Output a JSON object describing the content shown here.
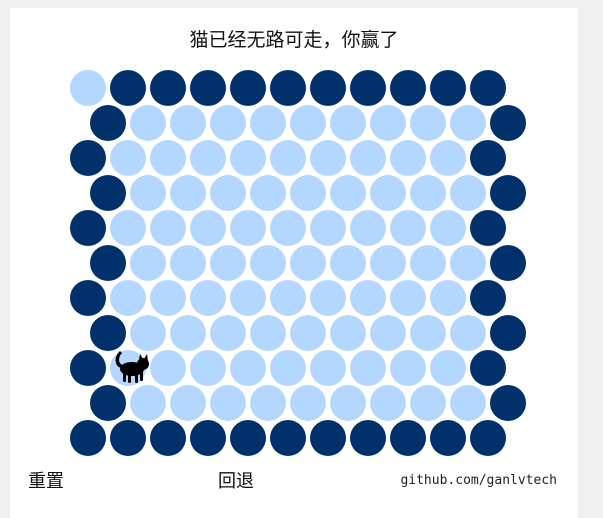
{
  "status_text": "猫已经无路可走，你赢了",
  "buttons": {
    "reset_label": "重置",
    "undo_label": "回退"
  },
  "footer_link": "github.com/ganlvtech",
  "colors": {
    "page_background": "#efefef",
    "panel_background": "#ffffff",
    "empty_cell": "#b3d7ff",
    "wall_cell": "#00316b",
    "cat": "#000000"
  },
  "board": {
    "rows": 11,
    "cols": 11,
    "cat_position": {
      "row": 8,
      "col": 1
    },
    "walls": [
      "0-1",
      "0-2",
      "0-3",
      "0-4",
      "0-5",
      "0-6",
      "0-7",
      "0-8",
      "0-9",
      "0-10",
      "1-0",
      "1-10",
      "2-0",
      "2-10",
      "3-0",
      "3-10",
      "4-0",
      "4-10",
      "5-0",
      "5-10",
      "6-0",
      "6-10",
      "7-0",
      "7-10",
      "8-0",
      "8-10",
      "9-0",
      "9-10",
      "10-0",
      "10-1",
      "10-2",
      "10-3",
      "10-4",
      "10-5",
      "10-6",
      "10-7",
      "10-8",
      "10-9",
      "10-10"
    ]
  }
}
